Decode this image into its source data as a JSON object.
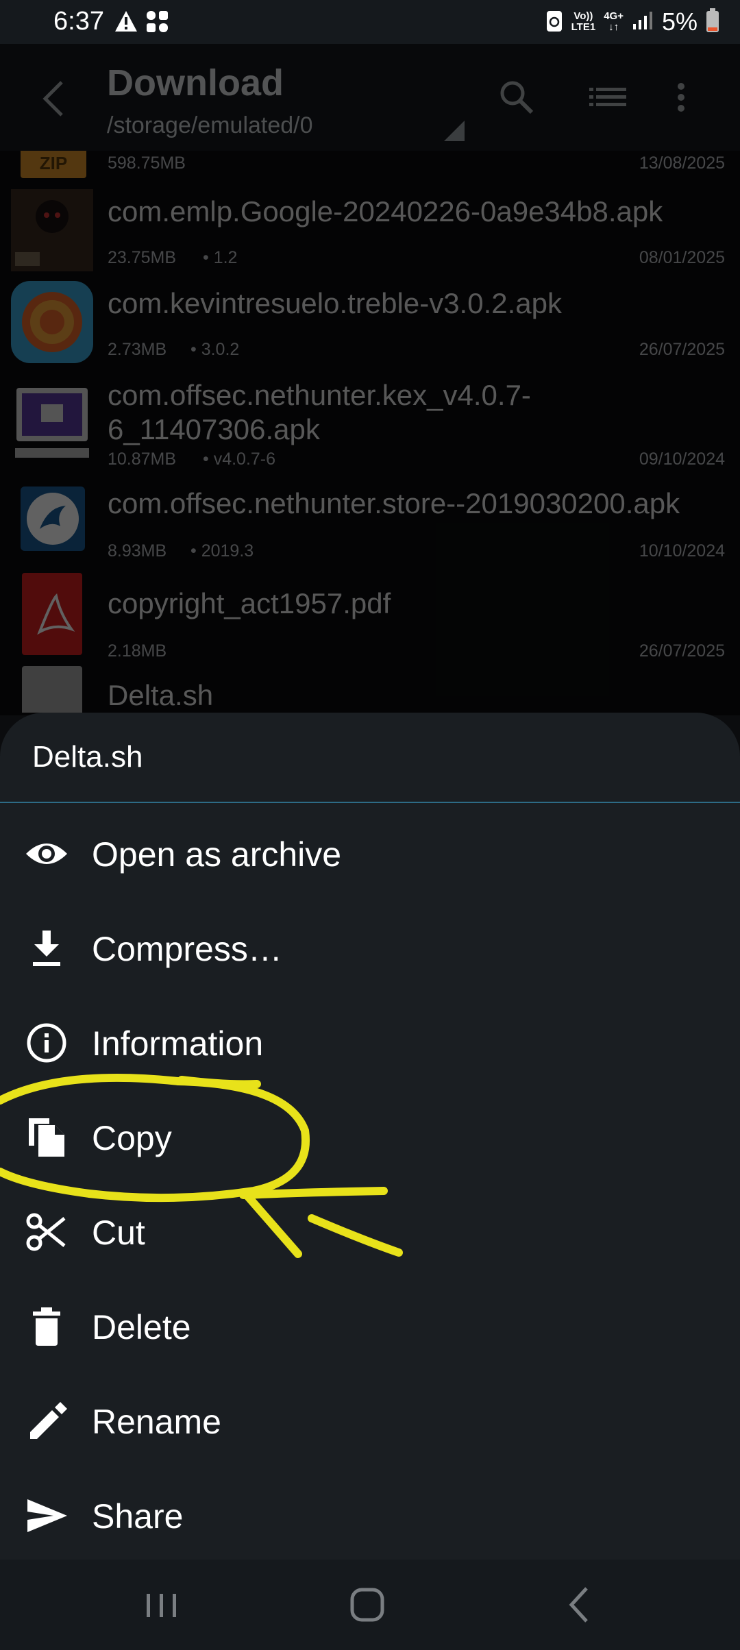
{
  "status_bar": {
    "time": "6:37",
    "net_top": "Vo))",
    "net_bottom": "LTE1",
    "net2_top": "4G+",
    "battery": "5%"
  },
  "app_bar": {
    "title": "Download",
    "path": "/storage/emulated/0"
  },
  "files": [
    {
      "name": "",
      "size": "598.75MB",
      "version": "",
      "date": "13/08/2025",
      "thumb_label": "ZIP",
      "thumb_icon": "zip-icon"
    },
    {
      "name": "com.emlp.Google-20240226-0a9e34b8.apk",
      "size": "23.75MB",
      "version": "1.2",
      "date": "08/01/2025",
      "thumb_icon": "game-thumbnail"
    },
    {
      "name": "com.kevintresuelo.treble-v3.0.2.apk",
      "size": "2.73MB",
      "version": "3.0.2",
      "date": "26/07/2025",
      "thumb_icon": "treble-app-icon"
    },
    {
      "name": "com.offsec.nethunter.kex_v4.0.7-6_11407306.apk",
      "size": "10.87MB",
      "version": "v4.0.7-6",
      "date": "09/10/2024",
      "thumb_icon": "kex-monitor-icon"
    },
    {
      "name": "com.offsec.nethunter.store--2019030200.apk",
      "size": "8.93MB",
      "version": "2019.3",
      "date": "10/10/2024",
      "thumb_icon": "nethunter-dragon-icon"
    },
    {
      "name": "copyright_act1957.pdf",
      "size": "2.18MB",
      "version": "",
      "date": "26/07/2025",
      "thumb_icon": "pdf-icon"
    },
    {
      "name": "Delta.sh",
      "size": "",
      "version": "",
      "date": "",
      "thumb_icon": "generic-file-icon"
    }
  ],
  "sheet": {
    "title": "Delta.sh",
    "items": [
      {
        "label": "Open as archive",
        "icon": "eye-icon"
      },
      {
        "label": "Compress…",
        "icon": "download-icon"
      },
      {
        "label": "Information",
        "icon": "info-icon"
      },
      {
        "label": "Copy",
        "icon": "copy-icon"
      },
      {
        "label": "Cut",
        "icon": "scissors-icon"
      },
      {
        "label": "Delete",
        "icon": "trash-icon"
      },
      {
        "label": "Rename",
        "icon": "pencil-icon"
      },
      {
        "label": "Share",
        "icon": "send-icon"
      }
    ]
  },
  "colors": {
    "background": "#0b0c0e",
    "sheet": "#1a1e22",
    "divider": "#2d6b86",
    "annotation": "#e8e21a"
  }
}
